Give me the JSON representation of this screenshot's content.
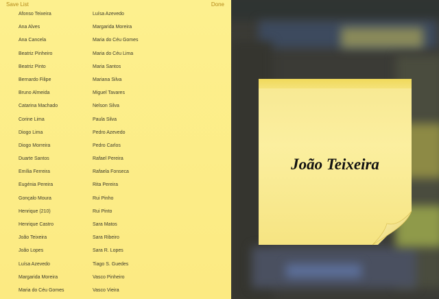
{
  "toolbar": {
    "save_label": "Save List",
    "done_label": "Done"
  },
  "names_col1": [
    "Afonso Teixeira",
    "Ana Alves",
    "Ana Cancela",
    "Beatriz Pinheiro",
    "Beatriz Pinto",
    "Bernardo Filipe",
    "Bruno Almeida",
    "Catarina Machado",
    "Corine Lima",
    "Diogo Lima",
    "Diogo Morreira",
    "Duarte Santos",
    "Emília Ferreira",
    "Eugénia Pereira",
    "Gonçalo Moura",
    "Henrique (210)",
    "Henrique Castro",
    "João Teixeira",
    "João Lopes",
    "Luísa Azevedo",
    "Margarida Moreira",
    "Maria do Céu Gomes"
  ],
  "names_col2": [
    "Luísa Azevedo",
    "Margarida Moreira",
    "Maria do Céu Gomes",
    "Maria do Céu Lima",
    "Maria Santos",
    "Mariana Silva",
    "Miguel Tavares",
    "Nelson Silva",
    "Paula Silva",
    "Pedro Azevedo",
    "Pedro Carlos",
    "Rafael Pereira",
    "Rafaela Fonseca",
    "Rita Pereira",
    "Rui Pinho",
    "Rui Pinto",
    "Sara Matos",
    "Sara Ribeiro",
    "Sara R. Lopes",
    "Tiago S. Guedes",
    "Vasco Pinheiro",
    "Vasco Vieira"
  ],
  "note": {
    "name": "João Teixeira"
  },
  "colors": {
    "note_yellow": "#fbef9f",
    "list_yellow": "#fdf08e",
    "accent": "#b58a1a"
  }
}
